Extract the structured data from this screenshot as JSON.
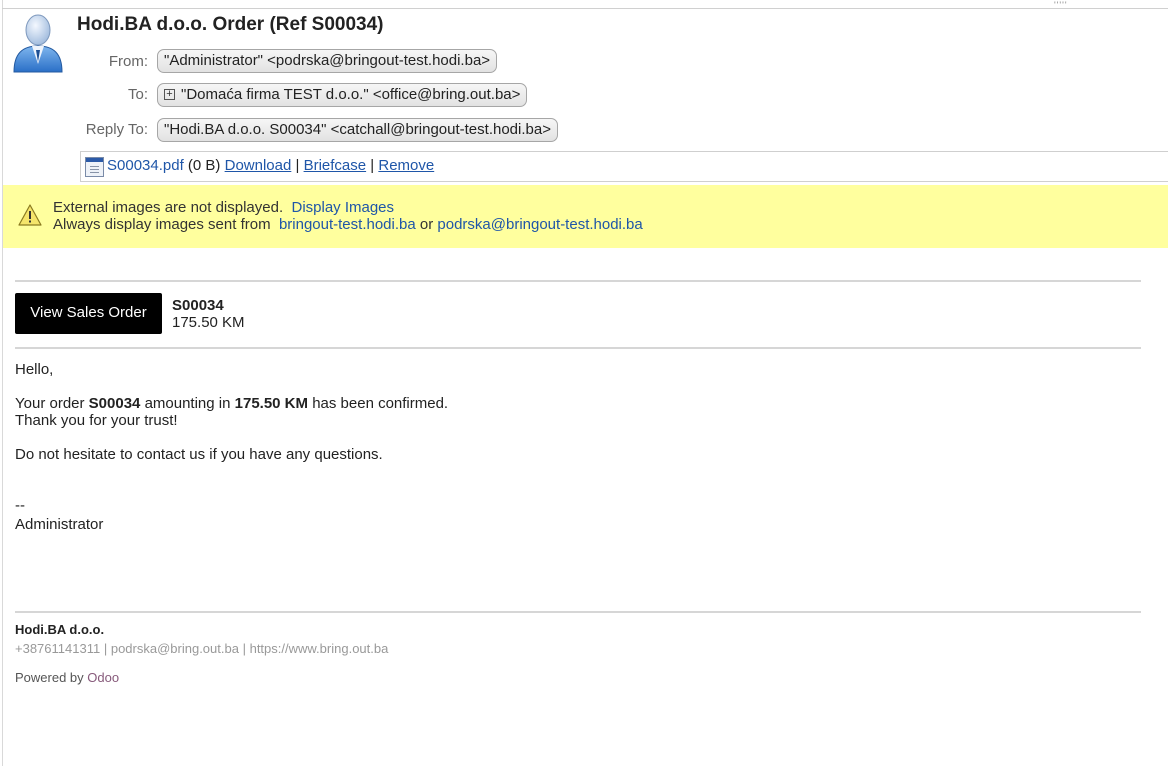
{
  "message": {
    "subject": "Hodi.BA d.o.o. Order (Ref S00034)",
    "from_label": "From:",
    "from": "\"Administrator\" <podrska@bringout-test.hodi.ba>",
    "to_label": "To:",
    "to": "\"Domaća firma TEST d.o.o.\" <office@bring.out.ba>",
    "reply_to_label": "Reply To:",
    "reply_to": "\"Hodi.BA d.o.o. S00034\" <catchall@bringout-test.hodi.ba>"
  },
  "attachment": {
    "file_name": "S00034.pdf",
    "size": "(0 B)",
    "download": "Download",
    "briefcase": "Briefcase",
    "remove": "Remove",
    "separator": "|"
  },
  "banner": {
    "line1": "External images are not displayed.",
    "display_images": "Display Images",
    "line2_prefix": "Always display images sent from",
    "domain": "bringout-test.hodi.ba",
    "or": "or",
    "email": "podrska@bringout-test.hodi.ba"
  },
  "order": {
    "button": "View Sales Order",
    "ref": "S00034",
    "amount": "175.50 KM"
  },
  "body": {
    "greeting": "Hello,",
    "line1_a": "Your order",
    "line1_ref": "S00034",
    "line1_b": "amounting in",
    "line1_amount": "175.50 KM",
    "line1_c": "has been confirmed.",
    "line2": "Thank you for your trust!",
    "line3": "Do not hesitate to contact us if you have any questions.",
    "sig_dash": "--",
    "sig_name": "Administrator"
  },
  "footer": {
    "company": "Hodi.BA d.o.o.",
    "phone": "+38761141311",
    "email": "podrska@bring.out.ba",
    "website": "https://www.bring.out.ba",
    "sep": "|",
    "powered_by": "Powered by",
    "odoo": "Odoo"
  },
  "icons": {
    "avatar": "user-avatar-icon",
    "expand": "plus-box-icon",
    "attachment": "document-icon",
    "warning": "warning-triangle-icon"
  }
}
